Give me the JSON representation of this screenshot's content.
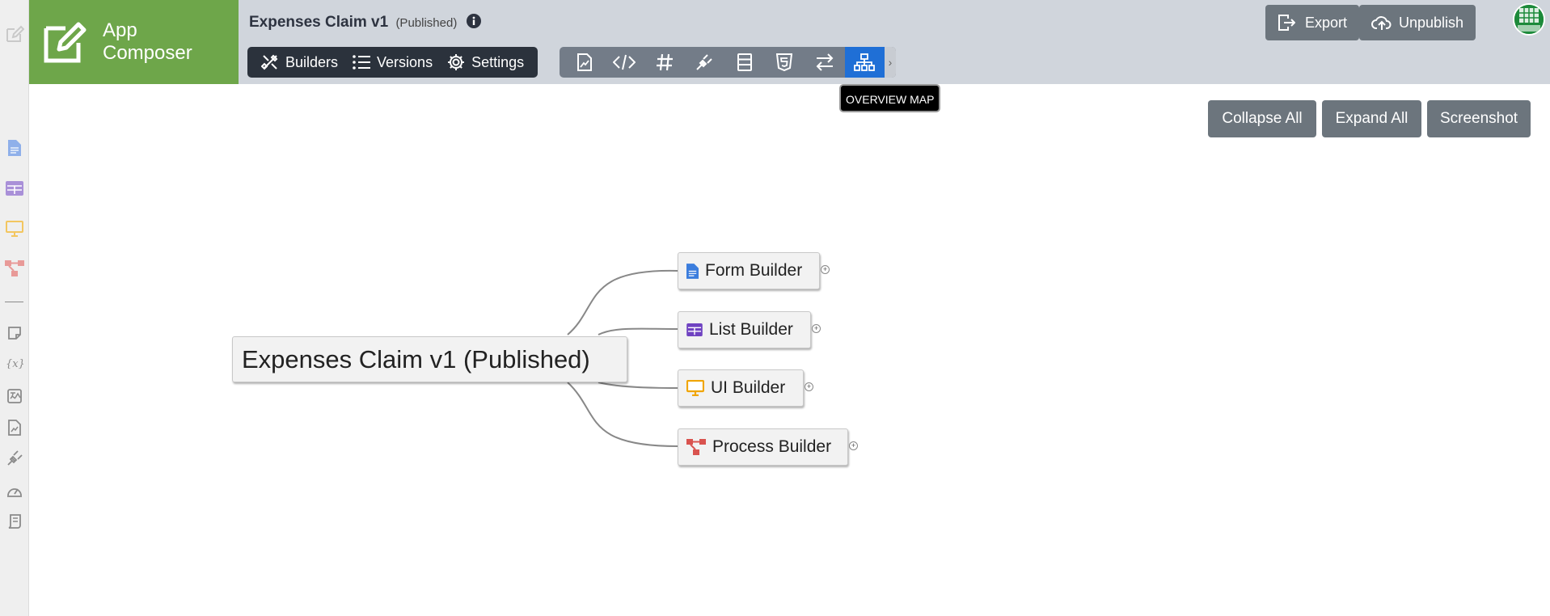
{
  "brand": {
    "line1": "App",
    "line2": "Composer"
  },
  "app": {
    "title": "Expenses Claim v1",
    "status": "(Published)"
  },
  "nav": [
    {
      "label": "Builders",
      "icon": "builders-icon"
    },
    {
      "label": "Versions",
      "icon": "versions-icon"
    },
    {
      "label": "Settings",
      "icon": "gear-icon"
    }
  ],
  "toolbar": {
    "icons": [
      "report-icon",
      "code-icon",
      "hashtag-icon",
      "plugin-icon",
      "table-icon",
      "html5-icon",
      "exchange-icon",
      "sitemap-icon"
    ],
    "active": "sitemap-icon",
    "tooltip": "OVERVIEW MAP"
  },
  "header_actions": {
    "export_label": "Export",
    "unpublish_label": "Unpublish"
  },
  "actions": {
    "collapse_label": "Collapse All",
    "expand_label": "Expand All",
    "screenshot_label": "Screenshot"
  },
  "mindmap": {
    "root": "Expenses Claim v1 (Published)",
    "children": [
      {
        "label": "Form Builder",
        "icon": "form-icon",
        "color": "#3b7ddd"
      },
      {
        "label": "List Builder",
        "icon": "list-icon",
        "color": "#6f42c1"
      },
      {
        "label": "UI Builder",
        "icon": "monitor-icon",
        "color": "#f0a500"
      },
      {
        "label": "Process Builder",
        "icon": "process-icon",
        "color": "#d9534f"
      }
    ]
  },
  "colors": {
    "brand": "#6ea64a",
    "active_tool": "#1f6fd6",
    "nav_bg": "#2b323c",
    "tool_bg": "#737c88",
    "button": "#6c757d"
  }
}
